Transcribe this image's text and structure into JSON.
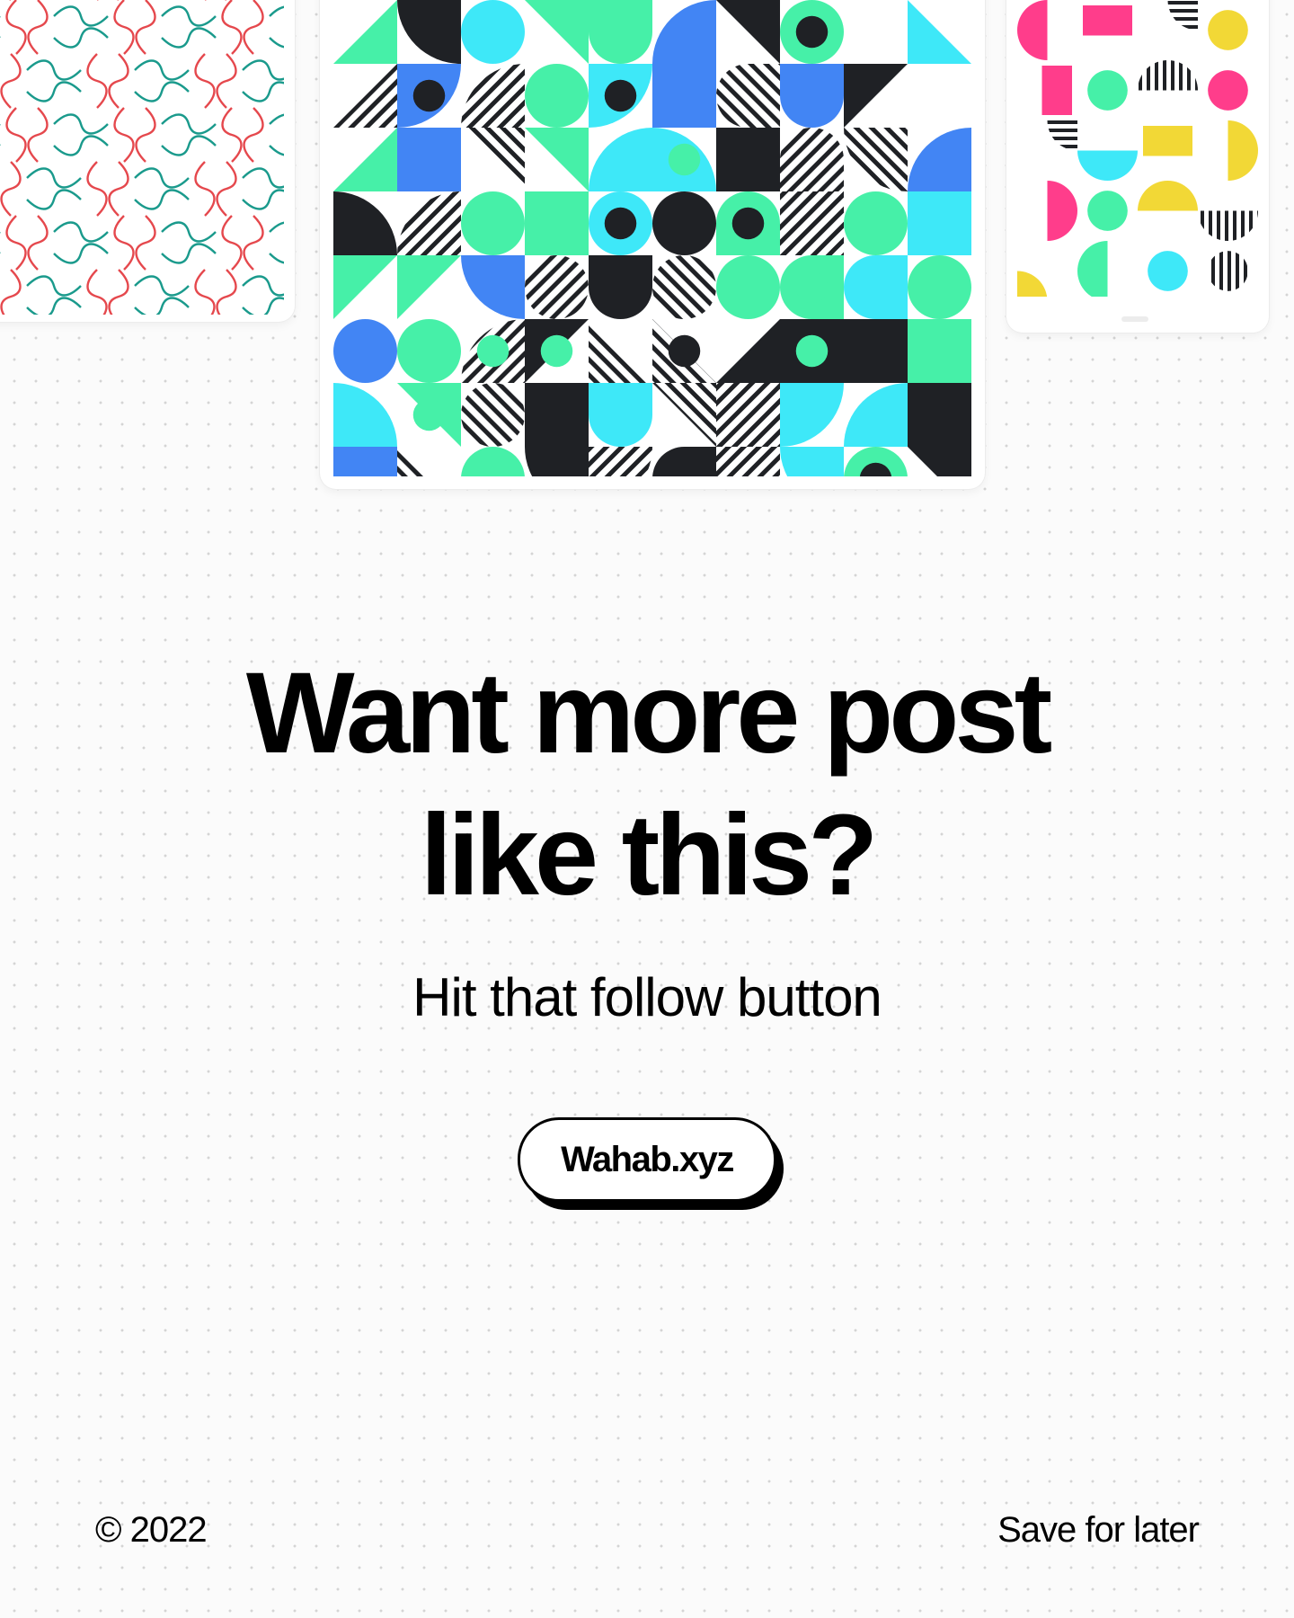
{
  "headline": {
    "line1": "Want more post",
    "line2": "like this?"
  },
  "subheadline": "Hit that follow button",
  "handle_button": "Wahab.xyz",
  "footer": {
    "copyright": "© 2022",
    "save": "Save for later"
  },
  "colors": {
    "background": "#fbfbfb",
    "dots": "#d4d4d4",
    "text": "#000000",
    "mint": "#46f0a8",
    "cyan": "#3ee8f8",
    "blue": "#4285f4",
    "dark": "#1f2125",
    "pink": "#ff3d8b",
    "yellow": "#f2d836",
    "line_red": "#e5484d",
    "line_teal": "#1a9a8c"
  },
  "icons": [
    "copyright-symbol"
  ]
}
